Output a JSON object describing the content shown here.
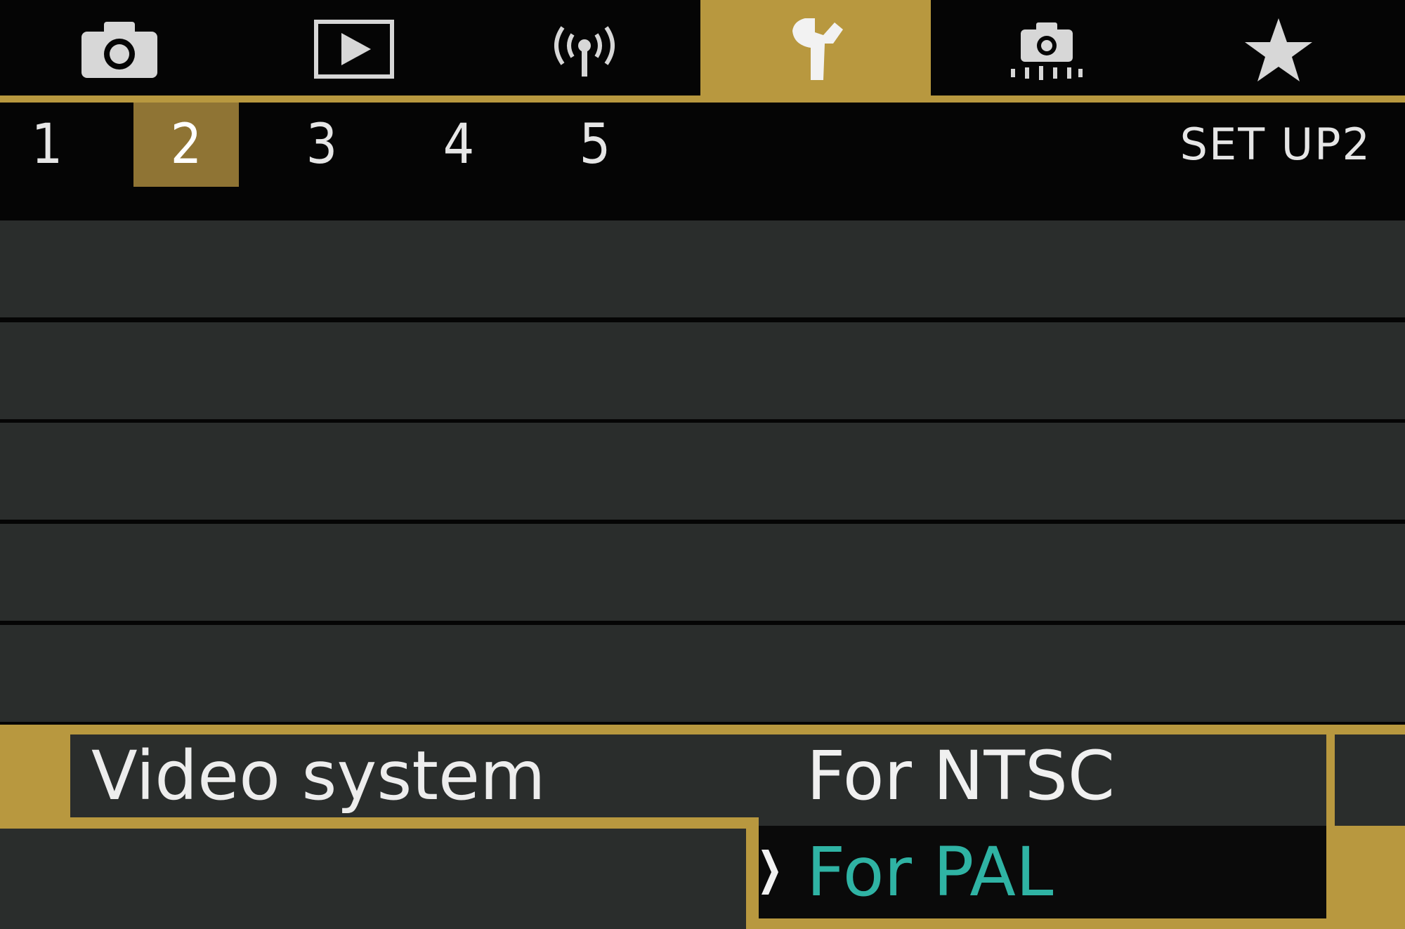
{
  "tabs": [
    {
      "icon": "camera-icon",
      "active": false
    },
    {
      "icon": "playback-icon",
      "active": false
    },
    {
      "icon": "wireless-icon",
      "active": false
    },
    {
      "icon": "wrench-icon",
      "active": true
    },
    {
      "icon": "custom-function-icon",
      "active": false
    },
    {
      "icon": "star-icon",
      "active": false
    }
  ],
  "pages": [
    "1",
    "2",
    "3",
    "4",
    "5"
  ],
  "active_page": "2",
  "page_title": "SET UP2",
  "menu": {
    "item_label": "Video system",
    "options": [
      "For NTSC",
      "For PAL"
    ],
    "selected_option": "For PAL"
  },
  "colors": {
    "accent_gold": "#b8983f",
    "row_gray": "#2a2d2c",
    "selected_text": "#2fb3a4"
  }
}
